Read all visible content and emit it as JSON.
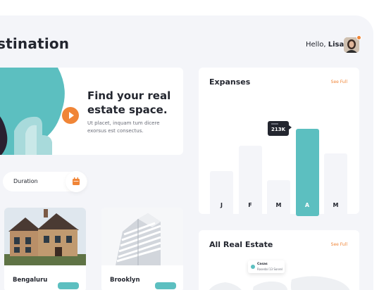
{
  "header": {
    "title": "stination",
    "greeting_prefix": "Hello,",
    "user_name": "Lisa!"
  },
  "hero": {
    "title_line1": "Find your real",
    "title_line2": "estate space.",
    "desc_line1": "Ut placet, inquam tum dicere",
    "desc_line2": "exorsus est consectus."
  },
  "filter": {
    "duration_label": "Duration"
  },
  "listings": [
    {
      "name": "Bengaluru"
    },
    {
      "name": "Brooklyn"
    }
  ],
  "expanses": {
    "title": "Expanses",
    "see_full": "See Full",
    "tooltip_value": "213K"
  },
  "chart_data": {
    "type": "bar",
    "categories": [
      "J",
      "F",
      "M",
      "A",
      "M"
    ],
    "values": [
      0.52,
      0.81,
      0.41,
      1.0,
      0.72
    ],
    "highlighted_index": 3,
    "highlighted_label": "213K",
    "colors": {
      "default": "#f4f5f9",
      "highlight": "#5cbfc0"
    }
  },
  "all_real_estate": {
    "title": "All Real Estate",
    "see_full": "See Full",
    "map_pin_title": "Casas",
    "map_pin_sub": "Rosedal 13 Sonrel"
  },
  "colors": {
    "accent": "#f08537",
    "teal": "#5cbfc0",
    "background": "#f4f5f9",
    "text": "#23262f"
  }
}
